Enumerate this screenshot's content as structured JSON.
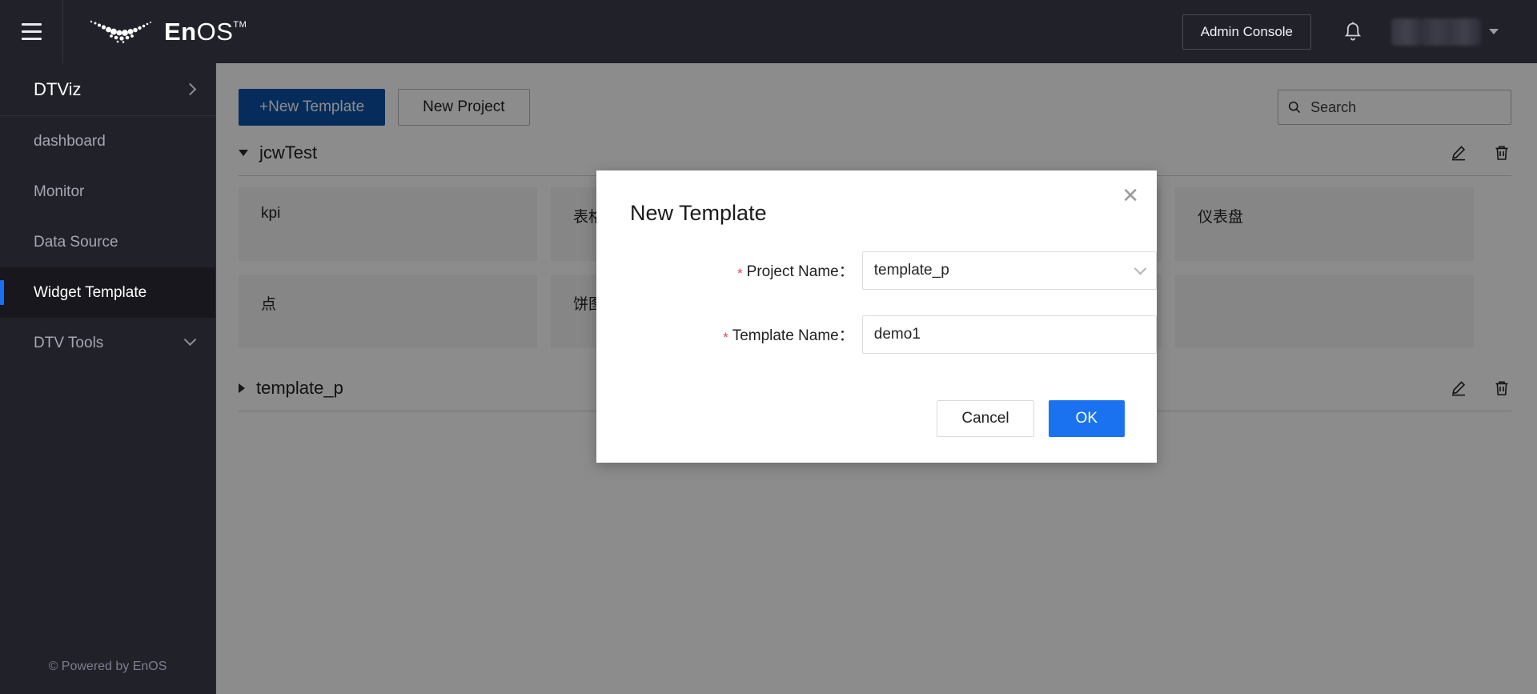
{
  "header": {
    "menu_icon": "hamburger-icon",
    "brand": {
      "en": "En",
      "os": "OS",
      "tm": "TM"
    },
    "admin_console_label": "Admin Console",
    "bell_icon": "notification-bell-icon",
    "user_caret_icon": "chevron-down-icon"
  },
  "sidebar": {
    "header_label": "DTViz",
    "header_chevron": "chevron-right-icon",
    "items": [
      {
        "label": "dashboard",
        "active": false,
        "chevron": ""
      },
      {
        "label": "Monitor",
        "active": false,
        "chevron": ""
      },
      {
        "label": "Data Source",
        "active": false,
        "chevron": ""
      },
      {
        "label": "Widget Template",
        "active": true,
        "chevron": ""
      },
      {
        "label": "DTV Tools",
        "active": false,
        "chevron": "chevron-down-icon"
      }
    ],
    "footer": "© Powered by EnOS"
  },
  "toolbar": {
    "new_template_label": "+New Template",
    "new_project_label": "New Project",
    "search_placeholder": "Search",
    "search_value": "",
    "search_icon": "search-icon"
  },
  "groups": [
    {
      "name": "jcwTest",
      "expanded": true,
      "edit_icon": "pencil-icon",
      "delete_icon": "trash-icon",
      "cards": [
        "kpi",
        "表格",
        "",
        "仪表盘",
        "点",
        "饼图",
        "",
        ""
      ]
    },
    {
      "name": "template_p",
      "expanded": false,
      "edit_icon": "pencil-icon",
      "delete_icon": "trash-icon",
      "cards": []
    }
  ],
  "modal": {
    "title": "New Template",
    "close_label": "✕",
    "project_name_label": "Project Name：",
    "project_name_value": "template_p",
    "project_name_chevron": "chevron-down-icon",
    "template_name_label": "Template Name：",
    "template_name_value": "demo1",
    "required_mark": "*",
    "cancel_label": "Cancel",
    "ok_label": "OK"
  },
  "colors": {
    "header_bg": "#212129",
    "sidebar_bg": "#212129",
    "active_accent": "#1b6ff5",
    "primary_button": "#0b50a6",
    "ok_button": "#1b72f0",
    "required_red": "#f5414f"
  }
}
